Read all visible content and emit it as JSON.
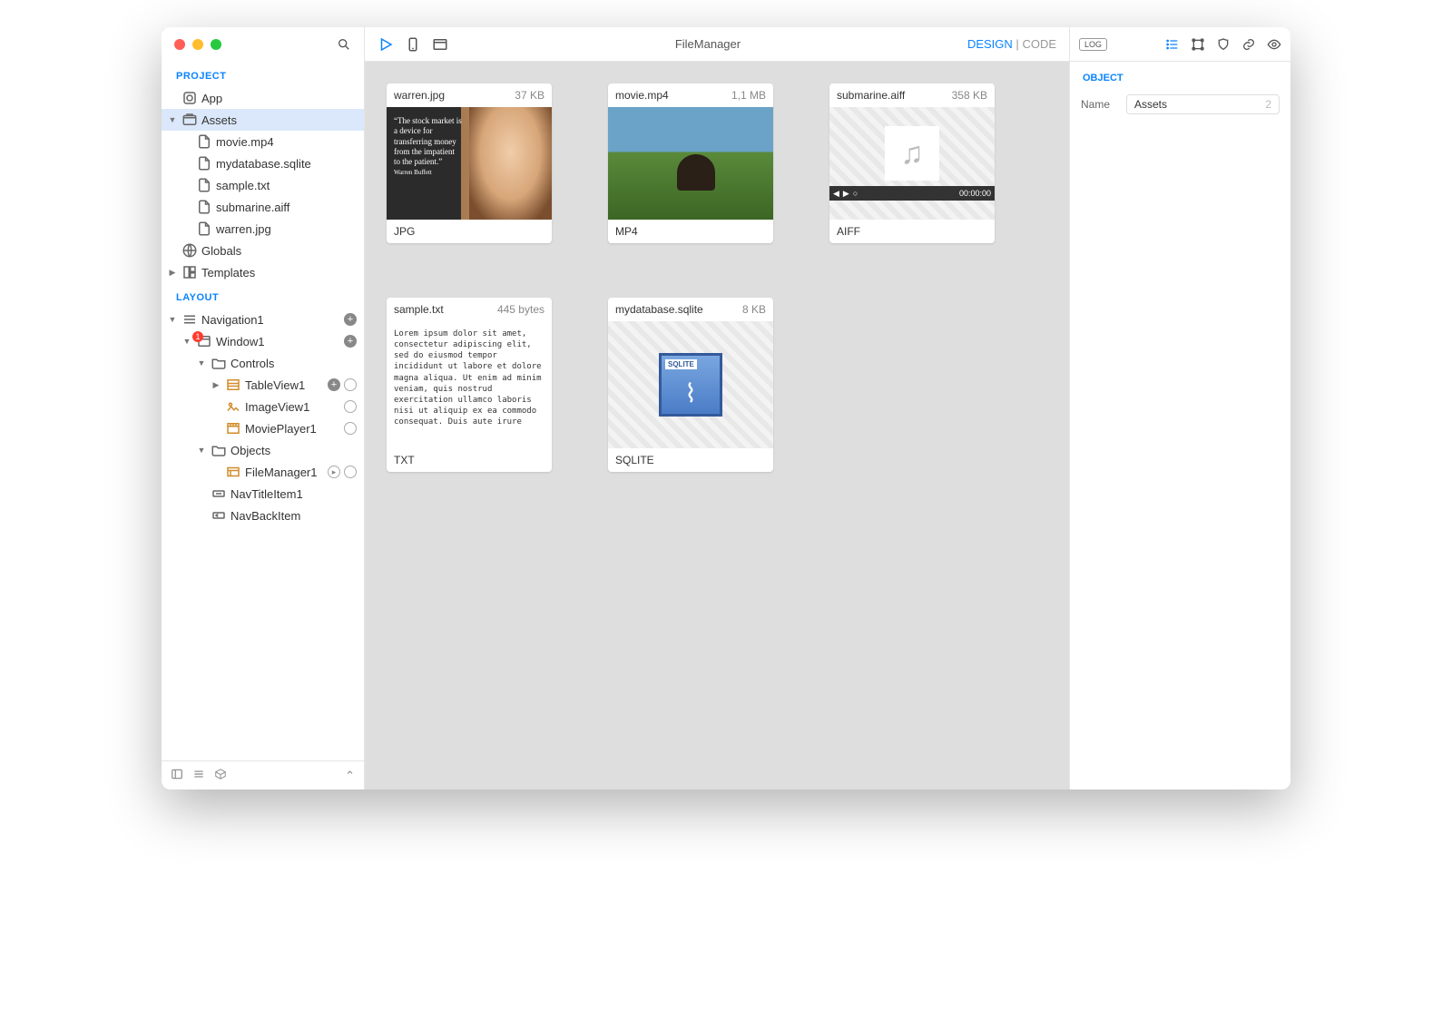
{
  "window": {
    "title": "FileManager"
  },
  "modes": {
    "design": "DESIGN",
    "sep": "|",
    "code": "CODE"
  },
  "sidebar": {
    "sections": {
      "project": "PROJECT",
      "layout": "LAYOUT"
    },
    "project": [
      {
        "label": "App",
        "icon": "app",
        "depth": 0
      },
      {
        "label": "Assets",
        "icon": "assets",
        "depth": 0,
        "selected": true,
        "expanded": true
      },
      {
        "label": "movie.mp4",
        "icon": "file",
        "depth": 1
      },
      {
        "label": "mydatabase.sqlite",
        "icon": "file",
        "depth": 1
      },
      {
        "label": "sample.txt",
        "icon": "file",
        "depth": 1
      },
      {
        "label": "submarine.aiff",
        "icon": "file",
        "depth": 1
      },
      {
        "label": "warren.jpg",
        "icon": "file",
        "depth": 1
      },
      {
        "label": "Globals",
        "icon": "globals",
        "depth": 0
      },
      {
        "label": "Templates",
        "icon": "templates",
        "depth": 0,
        "disc": "right"
      }
    ],
    "layout": [
      {
        "label": "Navigation1",
        "icon": "nav",
        "depth": 0,
        "disc": "down",
        "plus": true
      },
      {
        "label": "Window1",
        "icon": "window",
        "depth": 1,
        "disc": "down",
        "badge": "1",
        "plus": true
      },
      {
        "label": "Controls",
        "icon": "folder",
        "depth": 2,
        "disc": "down"
      },
      {
        "label": "TableView1",
        "icon": "table",
        "depth": 3,
        "disc": "right",
        "plus": true,
        "ring": true
      },
      {
        "label": "ImageView1",
        "icon": "image",
        "depth": 3,
        "ring": true
      },
      {
        "label": "MoviePlayer1",
        "icon": "movie",
        "depth": 3,
        "ring": true
      },
      {
        "label": "Objects",
        "icon": "folder",
        "depth": 2,
        "disc": "down"
      },
      {
        "label": "FileManager1",
        "icon": "fm",
        "depth": 3,
        "play": true,
        "ring": true
      },
      {
        "label": "NavTitleItem1",
        "icon": "navtitle",
        "depth": 2
      },
      {
        "label": "NavBackItem",
        "icon": "navback",
        "depth": 2
      }
    ]
  },
  "files": [
    {
      "name": "warren.jpg",
      "size": "37 KB",
      "type": "JPG",
      "preview": "jpg",
      "quote": "“The stock market is a device for transferring money from the impatient to the patient.”",
      "author": "Warren Buffett"
    },
    {
      "name": "movie.mp4",
      "size": "1,1 MB",
      "type": "MP4",
      "preview": "mp4"
    },
    {
      "name": "submarine.aiff",
      "size": "358 KB",
      "type": "AIFF",
      "preview": "aiff",
      "time": "00:00:00"
    },
    {
      "name": "sample.txt",
      "size": "445 bytes",
      "type": "TXT",
      "preview": "txt",
      "text": "Lorem ipsum dolor sit amet, consectetur adipiscing elit, sed do eiusmod tempor incididunt ut labore et dolore magna aliqua. Ut enim ad minim veniam, quis nostrud exercitation ullamco laboris nisi ut aliquip ex ea commodo consequat. Duis aute irure"
    },
    {
      "name": "mydatabase.sqlite",
      "size": "8 KB",
      "type": "SQLITE",
      "preview": "sqlite",
      "tag": "SQLITE"
    }
  ],
  "inspector": {
    "log": "LOG",
    "section": "OBJECT",
    "name_label": "Name",
    "name_value": "Assets",
    "name_count": "2"
  }
}
